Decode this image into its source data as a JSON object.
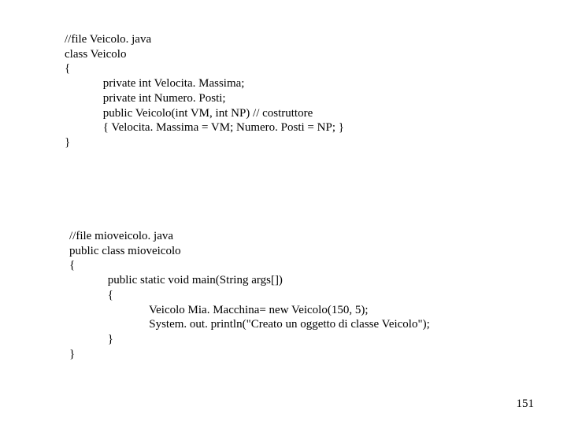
{
  "block1": {
    "l1": "//file Veicolo. java",
    "l2": "class Veicolo",
    "l3": "{",
    "l4": "             private int Velocita. Massima;",
    "l5": "             private int Numero. Posti;",
    "l6": "             public Veicolo(int VM, int NP) // costruttore",
    "l7": "             { Velocita. Massima = VM; Numero. Posti = NP; }",
    "l8": "}"
  },
  "block2": {
    "l1": "//file mioveicolo. java",
    "l2": "public class mioveicolo",
    "l3": "{",
    "l4": "             public static void main(String args[])",
    "l5": "             {",
    "l6": "                           Veicolo Mia. Macchina= new Veicolo(150, 5);",
    "l7": "                           System. out. println(\"Creato un oggetto di classe Veicolo\");",
    "l8": "             }",
    "l9": "}"
  },
  "pageNumber": "151"
}
